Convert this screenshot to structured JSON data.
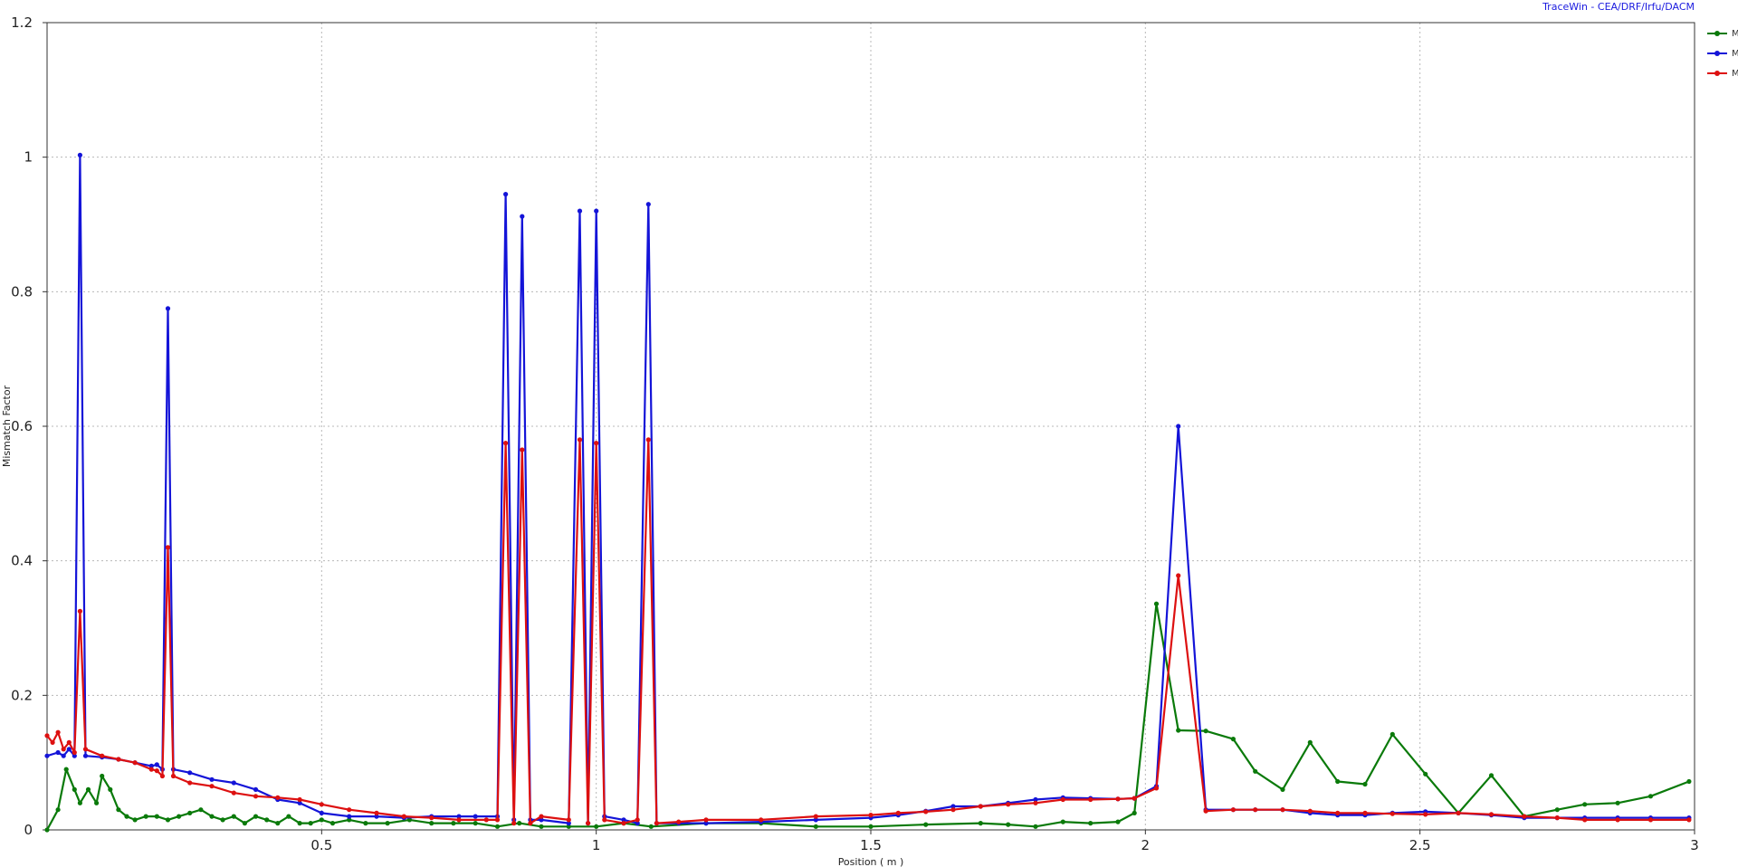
{
  "credit": "TraceWin - CEA/DRF/Irfu/DACM",
  "chart_data": {
    "type": "line",
    "xlabel": "Position ( m )",
    "ylabel": "Mismatch Factor",
    "xlim": [
      0,
      3
    ],
    "ylim": [
      0,
      1.2
    ],
    "xticks": [
      0.5,
      1,
      1.5,
      2,
      2.5,
      3
    ],
    "xtick_labels": [
      "0.5",
      "1",
      "1.5",
      "2",
      "2.5",
      "3"
    ],
    "yticks": [
      0,
      0.2,
      0.4,
      0.6,
      0.8,
      1,
      1.2
    ],
    "ytick_labels": [
      "0",
      "0.2",
      "0.4",
      "0.6",
      "0.8",
      "1",
      "1.2"
    ],
    "grid": true,
    "legend_position": "top-right",
    "series": [
      {
        "name": "Mz",
        "color": "#0a7a0a",
        "points": [
          [
            0.0,
            0.0
          ],
          [
            0.02,
            0.03
          ],
          [
            0.035,
            0.09
          ],
          [
            0.05,
            0.06
          ],
          [
            0.06,
            0.04
          ],
          [
            0.075,
            0.06
          ],
          [
            0.09,
            0.04
          ],
          [
            0.1,
            0.08
          ],
          [
            0.115,
            0.06
          ],
          [
            0.13,
            0.03
          ],
          [
            0.145,
            0.02
          ],
          [
            0.16,
            0.015
          ],
          [
            0.18,
            0.02
          ],
          [
            0.2,
            0.02
          ],
          [
            0.22,
            0.015
          ],
          [
            0.24,
            0.02
          ],
          [
            0.26,
            0.025
          ],
          [
            0.28,
            0.03
          ],
          [
            0.3,
            0.02
          ],
          [
            0.32,
            0.015
          ],
          [
            0.34,
            0.02
          ],
          [
            0.36,
            0.01
          ],
          [
            0.38,
            0.02
          ],
          [
            0.4,
            0.015
          ],
          [
            0.42,
            0.01
          ],
          [
            0.44,
            0.02
          ],
          [
            0.46,
            0.01
          ],
          [
            0.48,
            0.01
          ],
          [
            0.5,
            0.015
          ],
          [
            0.52,
            0.01
          ],
          [
            0.55,
            0.015
          ],
          [
            0.58,
            0.01
          ],
          [
            0.62,
            0.01
          ],
          [
            0.66,
            0.015
          ],
          [
            0.7,
            0.01
          ],
          [
            0.74,
            0.01
          ],
          [
            0.78,
            0.01
          ],
          [
            0.82,
            0.005
          ],
          [
            0.86,
            0.01
          ],
          [
            0.9,
            0.005
          ],
          [
            0.95,
            0.005
          ],
          [
            1.0,
            0.005
          ],
          [
            1.05,
            0.01
          ],
          [
            1.1,
            0.005
          ],
          [
            1.2,
            0.01
          ],
          [
            1.3,
            0.01
          ],
          [
            1.4,
            0.005
          ],
          [
            1.5,
            0.005
          ],
          [
            1.6,
            0.008
          ],
          [
            1.7,
            0.01
          ],
          [
            1.75,
            0.008
          ],
          [
            1.8,
            0.005
          ],
          [
            1.85,
            0.012
          ],
          [
            1.9,
            0.01
          ],
          [
            1.95,
            0.012
          ],
          [
            1.98,
            0.025
          ],
          [
            2.02,
            0.336
          ],
          [
            2.06,
            0.148
          ],
          [
            2.11,
            0.147
          ],
          [
            2.16,
            0.135
          ],
          [
            2.2,
            0.087
          ],
          [
            2.25,
            0.06
          ],
          [
            2.3,
            0.13
          ],
          [
            2.35,
            0.072
          ],
          [
            2.4,
            0.068
          ],
          [
            2.45,
            0.142
          ],
          [
            2.51,
            0.083
          ],
          [
            2.57,
            0.025
          ],
          [
            2.63,
            0.081
          ],
          [
            2.69,
            0.02
          ],
          [
            2.75,
            0.03
          ],
          [
            2.8,
            0.038
          ],
          [
            2.86,
            0.04
          ],
          [
            2.92,
            0.05
          ],
          [
            2.99,
            0.072
          ]
        ]
      },
      {
        "name": "My",
        "color": "#1414d8",
        "points": [
          [
            0.0,
            0.11
          ],
          [
            0.02,
            0.115
          ],
          [
            0.03,
            0.11
          ],
          [
            0.04,
            0.12
          ],
          [
            0.05,
            0.11
          ],
          [
            0.06,
            1.003
          ],
          [
            0.07,
            0.11
          ],
          [
            0.1,
            0.108
          ],
          [
            0.13,
            0.105
          ],
          [
            0.16,
            0.1
          ],
          [
            0.19,
            0.095
          ],
          [
            0.2,
            0.097
          ],
          [
            0.21,
            0.09
          ],
          [
            0.22,
            0.775
          ],
          [
            0.23,
            0.09
          ],
          [
            0.26,
            0.085
          ],
          [
            0.3,
            0.075
          ],
          [
            0.34,
            0.07
          ],
          [
            0.38,
            0.06
          ],
          [
            0.42,
            0.045
          ],
          [
            0.46,
            0.04
          ],
          [
            0.5,
            0.025
          ],
          [
            0.55,
            0.02
          ],
          [
            0.6,
            0.02
          ],
          [
            0.65,
            0.018
          ],
          [
            0.7,
            0.02
          ],
          [
            0.75,
            0.02
          ],
          [
            0.78,
            0.02
          ],
          [
            0.82,
            0.02
          ],
          [
            0.835,
            0.945
          ],
          [
            0.85,
            0.015
          ],
          [
            0.865,
            0.912
          ],
          [
            0.88,
            0.015
          ],
          [
            0.9,
            0.015
          ],
          [
            0.95,
            0.01
          ],
          [
            0.97,
            0.92
          ],
          [
            0.985,
            0.01
          ],
          [
            1.0,
            0.92
          ],
          [
            1.015,
            0.02
          ],
          [
            1.05,
            0.015
          ],
          [
            1.075,
            0.01
          ],
          [
            1.095,
            0.93
          ],
          [
            1.11,
            0.01
          ],
          [
            1.15,
            0.01
          ],
          [
            1.2,
            0.01
          ],
          [
            1.3,
            0.012
          ],
          [
            1.4,
            0.015
          ],
          [
            1.5,
            0.018
          ],
          [
            1.55,
            0.022
          ],
          [
            1.6,
            0.028
          ],
          [
            1.65,
            0.035
          ],
          [
            1.7,
            0.035
          ],
          [
            1.75,
            0.04
          ],
          [
            1.8,
            0.045
          ],
          [
            1.85,
            0.048
          ],
          [
            1.9,
            0.047
          ],
          [
            1.95,
            0.046
          ],
          [
            1.98,
            0.047
          ],
          [
            2.02,
            0.065
          ],
          [
            2.06,
            0.6
          ],
          [
            2.11,
            0.03
          ],
          [
            2.16,
            0.03
          ],
          [
            2.2,
            0.03
          ],
          [
            2.25,
            0.03
          ],
          [
            2.3,
            0.025
          ],
          [
            2.35,
            0.022
          ],
          [
            2.4,
            0.022
          ],
          [
            2.45,
            0.025
          ],
          [
            2.51,
            0.027
          ],
          [
            2.57,
            0.025
          ],
          [
            2.63,
            0.022
          ],
          [
            2.69,
            0.018
          ],
          [
            2.75,
            0.018
          ],
          [
            2.8,
            0.018
          ],
          [
            2.86,
            0.018
          ],
          [
            2.92,
            0.018
          ],
          [
            2.99,
            0.018
          ]
        ]
      },
      {
        "name": "Mx",
        "color": "#dd1010",
        "points": [
          [
            0.0,
            0.14
          ],
          [
            0.01,
            0.13
          ],
          [
            0.02,
            0.145
          ],
          [
            0.03,
            0.12
          ],
          [
            0.04,
            0.13
          ],
          [
            0.05,
            0.115
          ],
          [
            0.06,
            0.325
          ],
          [
            0.07,
            0.12
          ],
          [
            0.1,
            0.11
          ],
          [
            0.13,
            0.105
          ],
          [
            0.16,
            0.1
          ],
          [
            0.19,
            0.09
          ],
          [
            0.2,
            0.088
          ],
          [
            0.21,
            0.08
          ],
          [
            0.22,
            0.42
          ],
          [
            0.23,
            0.08
          ],
          [
            0.26,
            0.07
          ],
          [
            0.3,
            0.065
          ],
          [
            0.34,
            0.055
          ],
          [
            0.38,
            0.05
          ],
          [
            0.42,
            0.048
          ],
          [
            0.46,
            0.045
          ],
          [
            0.5,
            0.038
          ],
          [
            0.55,
            0.03
          ],
          [
            0.6,
            0.025
          ],
          [
            0.65,
            0.02
          ],
          [
            0.7,
            0.018
          ],
          [
            0.75,
            0.015
          ],
          [
            0.8,
            0.015
          ],
          [
            0.82,
            0.015
          ],
          [
            0.835,
            0.575
          ],
          [
            0.85,
            0.01
          ],
          [
            0.865,
            0.565
          ],
          [
            0.88,
            0.01
          ],
          [
            0.9,
            0.02
          ],
          [
            0.95,
            0.015
          ],
          [
            0.97,
            0.58
          ],
          [
            0.985,
            0.01
          ],
          [
            1.0,
            0.575
          ],
          [
            1.015,
            0.015
          ],
          [
            1.05,
            0.01
          ],
          [
            1.075,
            0.015
          ],
          [
            1.095,
            0.58
          ],
          [
            1.11,
            0.01
          ],
          [
            1.15,
            0.012
          ],
          [
            1.2,
            0.015
          ],
          [
            1.3,
            0.015
          ],
          [
            1.4,
            0.02
          ],
          [
            1.5,
            0.022
          ],
          [
            1.55,
            0.025
          ],
          [
            1.6,
            0.027
          ],
          [
            1.65,
            0.03
          ],
          [
            1.7,
            0.035
          ],
          [
            1.75,
            0.038
          ],
          [
            1.8,
            0.04
          ],
          [
            1.85,
            0.045
          ],
          [
            1.9,
            0.045
          ],
          [
            1.95,
            0.046
          ],
          [
            1.98,
            0.047
          ],
          [
            2.02,
            0.062
          ],
          [
            2.06,
            0.378
          ],
          [
            2.11,
            0.028
          ],
          [
            2.16,
            0.03
          ],
          [
            2.2,
            0.03
          ],
          [
            2.25,
            0.03
          ],
          [
            2.3,
            0.028
          ],
          [
            2.35,
            0.025
          ],
          [
            2.4,
            0.025
          ],
          [
            2.45,
            0.024
          ],
          [
            2.51,
            0.023
          ],
          [
            2.57,
            0.025
          ],
          [
            2.63,
            0.023
          ],
          [
            2.69,
            0.02
          ],
          [
            2.75,
            0.018
          ],
          [
            2.8,
            0.015
          ],
          [
            2.86,
            0.015
          ],
          [
            2.92,
            0.015
          ],
          [
            2.99,
            0.015
          ]
        ]
      }
    ]
  },
  "legend": {
    "items": [
      {
        "label": "Mz",
        "color": "#0a7a0a"
      },
      {
        "label": "My",
        "color": "#1414d8"
      },
      {
        "label": "Mx",
        "color": "#dd1010"
      }
    ]
  }
}
